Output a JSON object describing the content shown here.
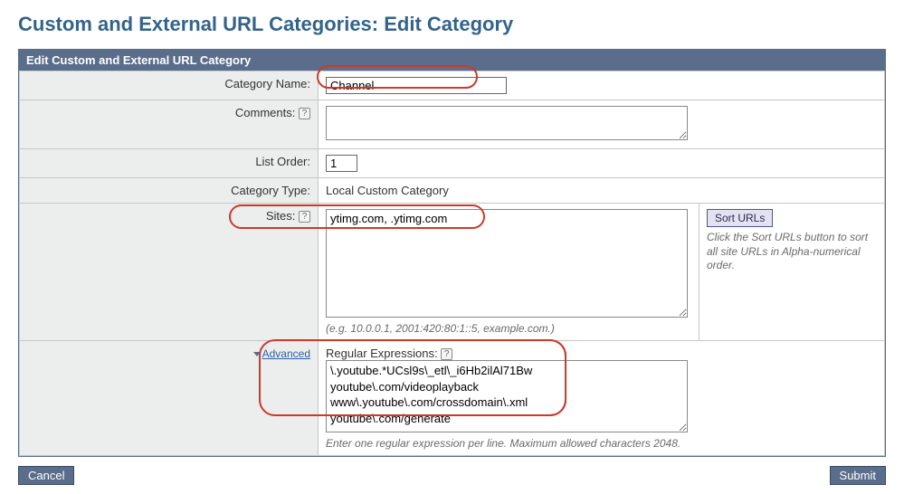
{
  "page": {
    "title": "Custom and External URL Categories: Edit Category",
    "section_header": "Edit Custom and External URL Category"
  },
  "labels": {
    "category_name": "Category Name:",
    "comments": "Comments:",
    "list_order": "List Order:",
    "category_type": "Category Type:",
    "sites": "Sites:",
    "advanced": "Advanced",
    "regex": "Regular Expressions:"
  },
  "fields": {
    "category_name": "Channel",
    "comments": "",
    "list_order": "1",
    "category_type": "Local Custom Category",
    "sites": "ytimg.com, .ytimg.com",
    "regex": "\\.youtube.*UCsl9s\\_etl\\_i6Hb2ilAl71Bw\nyoutube\\.com/videoplayback\nwww\\.youtube\\.com/crossdomain\\.xml\nyoutube\\.com/generate"
  },
  "hints": {
    "sites_example": "(e.g. 10.0.0.1, 2001:420:80:1::5, example.com.)",
    "sort_urls": "Click the Sort URLs button to sort all site URLs in Alpha-numerical order.",
    "regex_hint": "Enter one regular expression per line. Maximum allowed characters 2048."
  },
  "buttons": {
    "sort_urls": "Sort URLs",
    "cancel": "Cancel",
    "submit": "Submit"
  }
}
